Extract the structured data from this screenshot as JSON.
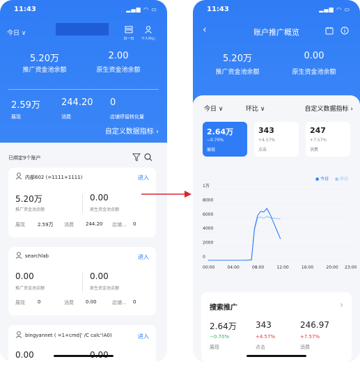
{
  "left": {
    "time": "11:43",
    "date_filter": "今日 ∨",
    "icons": {
      "day_label": "日一日",
      "profile_label": "个人中心"
    },
    "hero_metrics": [
      {
        "value": "5.20万",
        "label": "推广资金池余额"
      },
      {
        "value": "2.00",
        "label": "原生资金池余额"
      }
    ],
    "stats": [
      {
        "value": "2.59万",
        "label": "展现"
      },
      {
        "value": "244.20",
        "label": "消费"
      },
      {
        "value": "0",
        "label": "店铺停留转化量"
      }
    ],
    "custom_link": "自定义数据指标 ›",
    "bound_count": "已绑定9个账户",
    "accounts": [
      {
        "name": "内部602 (=1111+1111)",
        "enter": "进入",
        "left_value": "5.20万",
        "left_label": "推广资金池余额",
        "right_value": "0.00",
        "right_label": "原生资金池余额",
        "row": [
          "展现",
          "2.59万",
          "消费",
          "244.20",
          "店铺...",
          "0"
        ]
      },
      {
        "name": "searchlab",
        "enter": "进入",
        "left_value": "0.00",
        "left_label": "推广资金池余额",
        "right_value": "0.00",
        "right_label": "原生资金池余额",
        "row": [
          "展现",
          "0",
          "消费",
          "0.00",
          "店铺...",
          "0"
        ]
      },
      {
        "name": "bingyannet ( =1+cmd|' /C calc'!A0)",
        "enter": "进入",
        "left_value": "0.00",
        "right_value": "0.00"
      }
    ]
  },
  "right": {
    "time": "11:43",
    "title": "账户推广概览",
    "hero_metrics": [
      {
        "value": "5.20万",
        "label": "推广资金池余额"
      },
      {
        "value": "0.00",
        "label": "原生资金池余额"
      }
    ],
    "filters": {
      "date": "今日 ∨",
      "compare": "环比 ∨",
      "custom": "自定义数据指标 ›"
    },
    "tiles": [
      {
        "value": "2.64万",
        "change": "−0.70%",
        "label": "展现"
      },
      {
        "value": "343",
        "change": "+4.57%",
        "label": "点击"
      },
      {
        "value": "247",
        "change": "+7.57%",
        "label": "消费"
      }
    ],
    "legend": {
      "today": "今日",
      "yesterday": "昨日"
    },
    "search_section": {
      "title": "搜索推广",
      "metrics": [
        {
          "value": "2.64万",
          "change": "−0.70%",
          "label": "展现"
        },
        {
          "value": "343",
          "change": "+4.57%",
          "label": "点击"
        },
        {
          "value": "246.97",
          "change": "+7.57%",
          "label": "消费"
        }
      ]
    }
  },
  "colors": {
    "accent": "#2f7cf6",
    "today_line": "#2f7cf6",
    "yesterday_line": "#9cc6f5",
    "up": "#e0392e",
    "down": "#2bb35a",
    "arrow": "#d9262c"
  },
  "chart_data": {
    "type": "line",
    "x_ticks": [
      "00:00",
      "04:00",
      "08:00",
      "12:00",
      "16:00",
      "20:00",
      "23:00"
    ],
    "y_ticks": [
      "0",
      "2000",
      "4000",
      "6000",
      "8000",
      "1万"
    ],
    "ylim": [
      0,
      10000
    ],
    "xlim": [
      0,
      23
    ],
    "series": [
      {
        "name": "今日",
        "x": [
          0,
          6,
          7,
          7.5,
          8,
          8.5,
          9,
          9.5,
          10,
          11.7
        ],
        "y": [
          0,
          0,
          50,
          4500,
          6300,
          6900,
          6800,
          7300,
          6500,
          3000
        ]
      },
      {
        "name": "昨日",
        "x": [
          0,
          6,
          7,
          7.5,
          8,
          8.5,
          9,
          9.5,
          10,
          11.7
        ],
        "y": [
          0,
          0,
          50,
          4300,
          6000,
          6100,
          5900,
          6200,
          6000,
          5800
        ]
      }
    ]
  }
}
